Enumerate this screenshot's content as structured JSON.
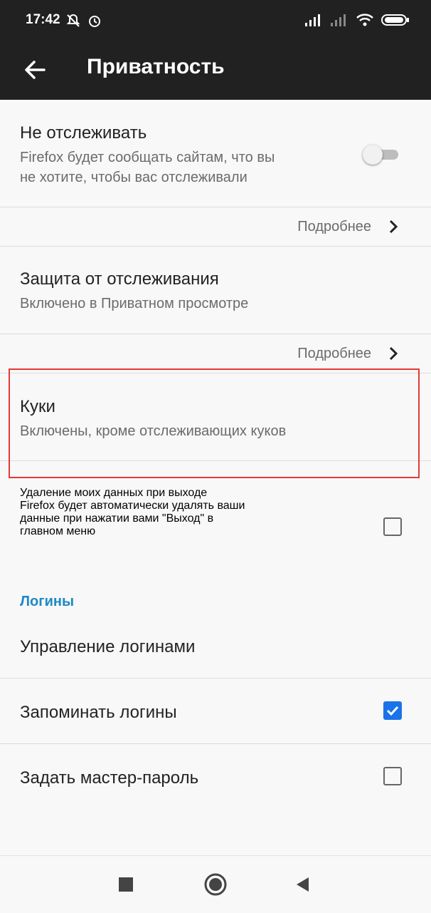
{
  "status_bar": {
    "time": "17:42"
  },
  "toolbar": {
    "title": "Приватность"
  },
  "dnt": {
    "title": "Не отслеживать",
    "summary_l1": "Firefox будет сообщать сайтам, что вы",
    "summary_l2": "не хотите, чтобы вас отслеживали",
    "enabled": false
  },
  "more1": {
    "label": "Подробнее"
  },
  "tp": {
    "title": "Защита от отслеживания",
    "summary": "Включено в Приватном просмотре"
  },
  "more2": {
    "label": "Подробнее"
  },
  "cookies": {
    "title": "Куки",
    "summary": "Включены, кроме отслеживающих куков"
  },
  "clear": {
    "title": "Удаление моих данных при выходе",
    "summary_l1": "Firefox будет автоматически удалять ваши",
    "summary_l2": "данные при нажатии вами \"Выход\" в",
    "summary_l3": "главном меню",
    "checked": false
  },
  "logins": {
    "header": "Логины",
    "manage": "Управление логинами",
    "remember": "Запоминать логины",
    "remember_checked": true,
    "master": "Задать мастер-пароль",
    "master_checked": false
  },
  "colors": {
    "toolbar_bg": "#212121",
    "accent": "#1a73e8",
    "section": "#1e88c5",
    "highlight": "#e53935"
  },
  "icons": [
    "back-arrow-icon",
    "chevron-right-icon",
    "mute-icon",
    "alarm-icon",
    "signal-icon",
    "wifi-icon",
    "battery-icon",
    "recents-icon",
    "home-icon",
    "back-nav-icon"
  ]
}
